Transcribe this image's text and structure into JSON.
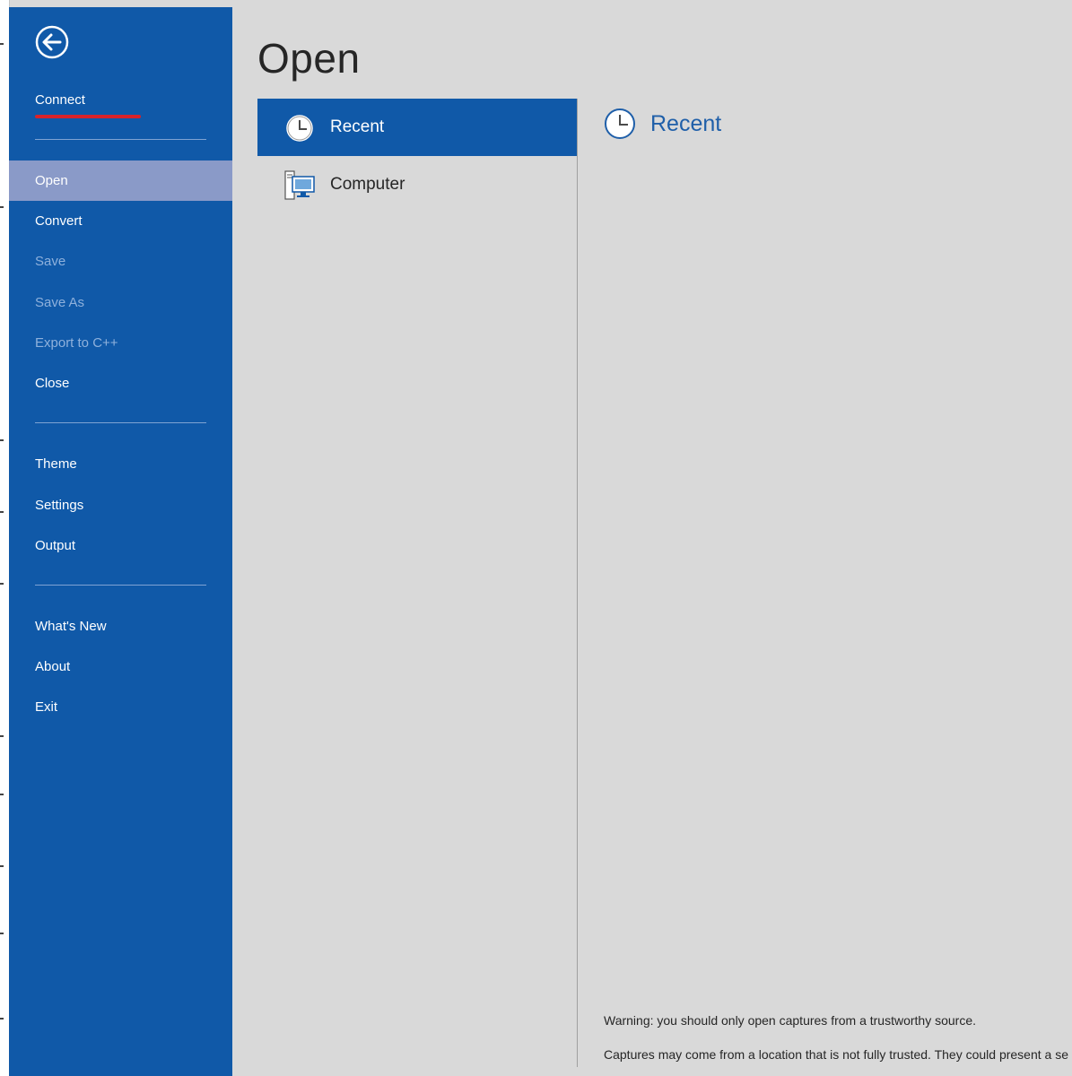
{
  "sidebar": {
    "connect": "Connect",
    "group1": [
      "Open",
      "Convert",
      "Save",
      "Save As",
      "Export to C++",
      "Close"
    ],
    "group2": [
      "Theme",
      "Settings",
      "Output"
    ],
    "group3": [
      "What's New",
      "About",
      "Exit"
    ],
    "selected": "Open",
    "disabled": [
      "Save",
      "Save As",
      "Export to C++"
    ]
  },
  "main": {
    "title": "Open",
    "places": [
      {
        "label": "Recent",
        "icon": "clock-icon",
        "selected": true
      },
      {
        "label": "Computer",
        "icon": "computer-icon",
        "selected": false
      }
    ],
    "recent_header": "Recent",
    "warning_line1": "Warning: you should only open captures from a trustworthy source.",
    "warning_line2": "Captures may come from a location that is not fully trusted. They could present a se"
  },
  "colors": {
    "sidebar_bg": "#1059a8",
    "selected_nav": "#8a9ac8",
    "accent_underline": "#d8232a",
    "recent_text": "#1f5fa9"
  }
}
